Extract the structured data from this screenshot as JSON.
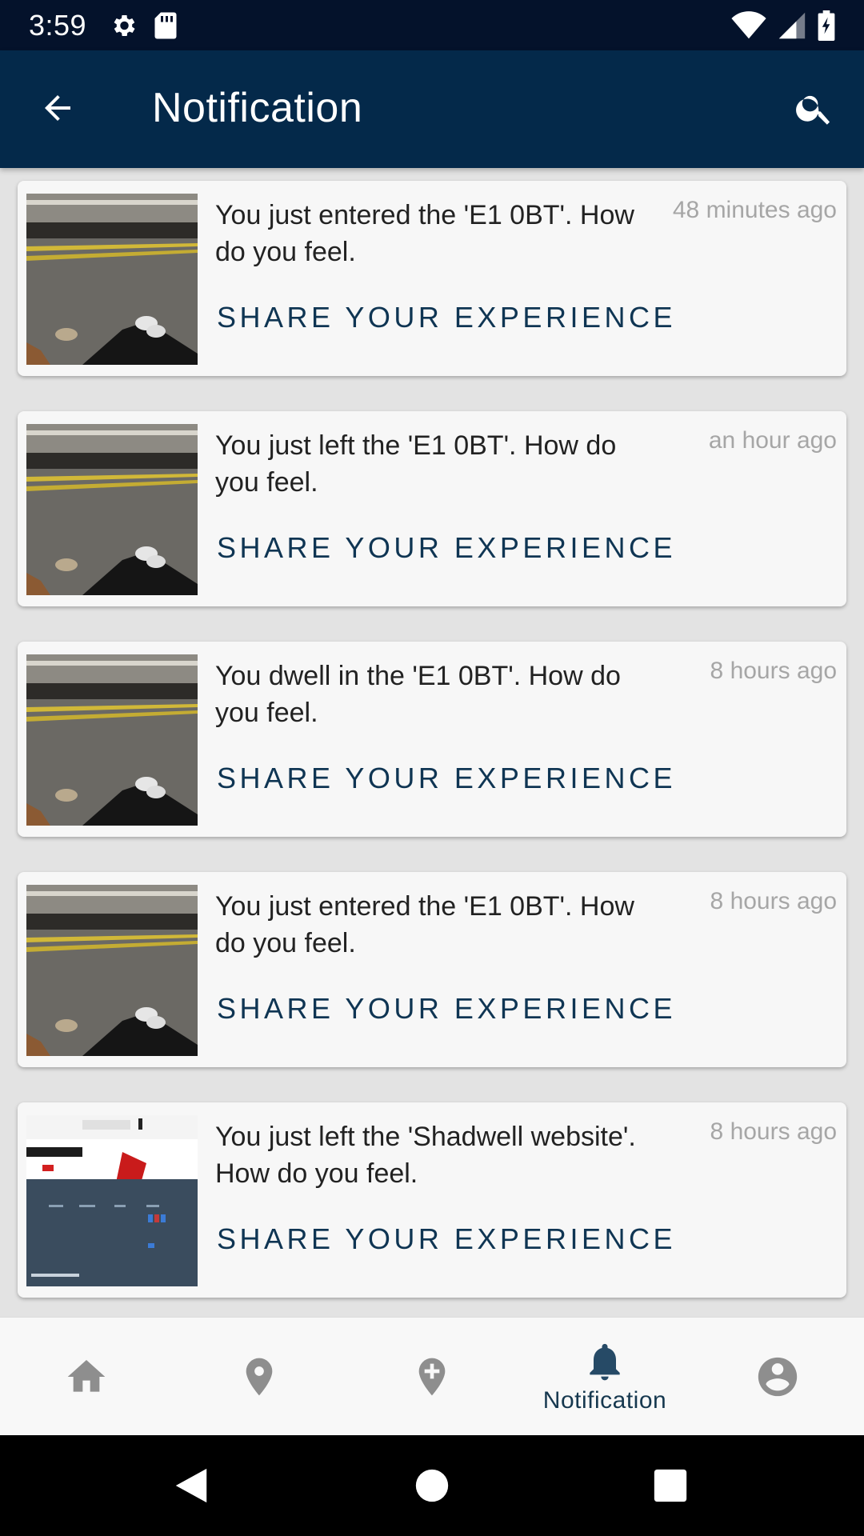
{
  "status_bar": {
    "time": "3:59"
  },
  "app_bar": {
    "title": "Notification"
  },
  "notifications": [
    {
      "message": "You just entered the 'E1 0BT'. How do you feel.",
      "time": "48 minutes ago",
      "action": "SHARE YOUR EXPERIENCE",
      "thumbnail": "station-platform-photo"
    },
    {
      "message": "You just left the 'E1 0BT'. How do you feel.",
      "time": "an hour ago",
      "action": "SHARE YOUR EXPERIENCE",
      "thumbnail": "station-platform-photo"
    },
    {
      "message": "You dwell in the 'E1 0BT'. How do you feel.",
      "time": "8 hours ago",
      "action": "SHARE YOUR EXPERIENCE",
      "thumbnail": "station-platform-photo"
    },
    {
      "message": "You just entered the 'E1 0BT'. How do you feel.",
      "time": "8 hours ago",
      "action": "SHARE YOUR EXPERIENCE",
      "thumbnail": "station-platform-photo"
    },
    {
      "message": "You just left the 'Shadwell website'. How do you feel.",
      "time": "8 hours ago",
      "action": "SHARE YOUR EXPERIENCE",
      "thumbnail": "website-screenshot"
    }
  ],
  "bottom_nav": {
    "items": [
      {
        "icon": "home-icon",
        "label": ""
      },
      {
        "icon": "map-pin-icon",
        "label": ""
      },
      {
        "icon": "add-location-icon",
        "label": ""
      },
      {
        "icon": "bell-icon",
        "label": "Notification"
      },
      {
        "icon": "account-icon",
        "label": ""
      }
    ]
  },
  "colors": {
    "status_bar": "#04122b",
    "app_bar": "#04294a",
    "accent": "#0f3553",
    "nav_icon_inactive": "#8e8e8e",
    "nav_icon_active": "#264a66"
  }
}
